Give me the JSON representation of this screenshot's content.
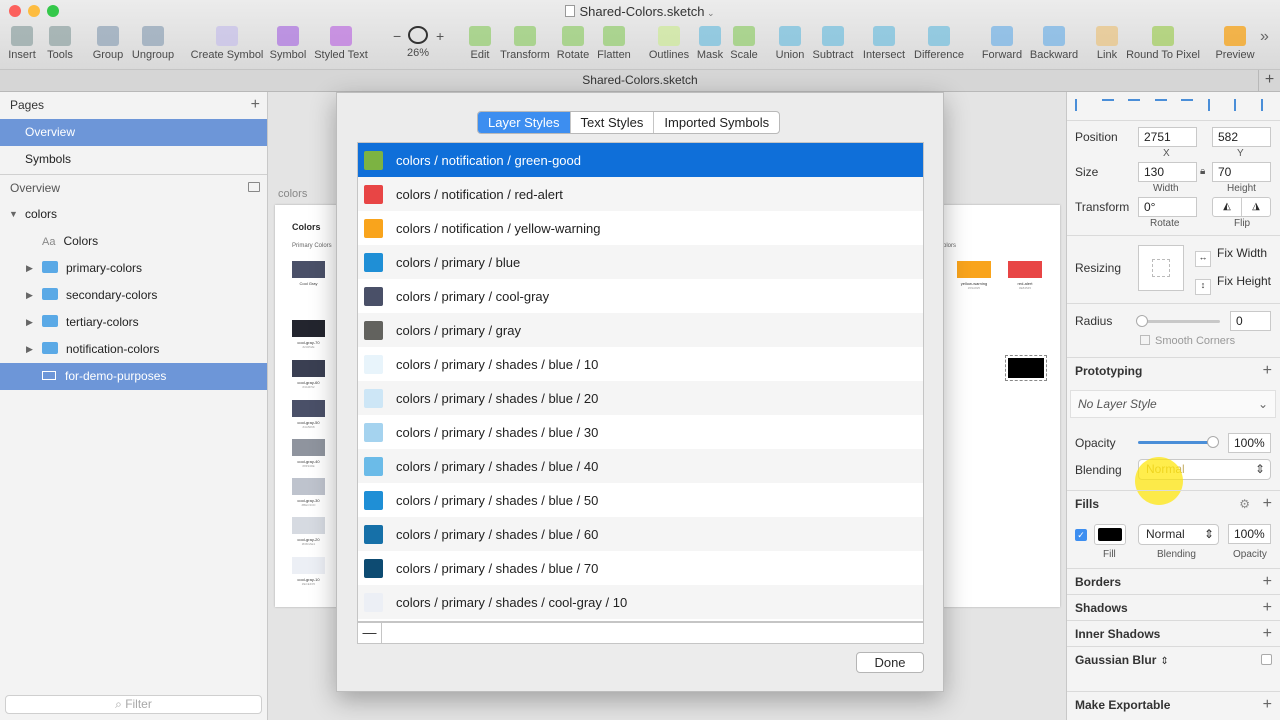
{
  "window": {
    "title": "Shared-Colors.sketch",
    "tab_title": "Shared-Colors.sketch"
  },
  "toolbar": {
    "items": [
      {
        "label": "Insert",
        "icon": "insert-icon"
      },
      {
        "label": "Tools",
        "icon": "tools-icon"
      },
      {
        "label": "Group",
        "icon": "group-icon"
      },
      {
        "label": "Ungroup",
        "icon": "ungroup-icon"
      },
      {
        "label": "Create Symbol",
        "icon": "create-symbol-icon"
      },
      {
        "label": "Symbol",
        "icon": "symbol-icon"
      },
      {
        "label": "Styled Text",
        "icon": "styled-text-icon"
      },
      {
        "label": "26%",
        "icon": "zoom-icon"
      },
      {
        "label": "Edit",
        "icon": "edit-icon"
      },
      {
        "label": "Transform",
        "icon": "transform-icon"
      },
      {
        "label": "Rotate",
        "icon": "rotate-icon"
      },
      {
        "label": "Flatten",
        "icon": "flatten-icon"
      },
      {
        "label": "Outlines",
        "icon": "outlines-icon"
      },
      {
        "label": "Mask",
        "icon": "mask-icon"
      },
      {
        "label": "Scale",
        "icon": "scale-icon"
      },
      {
        "label": "Union",
        "icon": "union-icon"
      },
      {
        "label": "Subtract",
        "icon": "subtract-icon"
      },
      {
        "label": "Intersect",
        "icon": "intersect-icon"
      },
      {
        "label": "Difference",
        "icon": "difference-icon"
      },
      {
        "label": "Forward",
        "icon": "forward-icon"
      },
      {
        "label": "Backward",
        "icon": "backward-icon"
      },
      {
        "label": "Link",
        "icon": "link-icon"
      },
      {
        "label": "Round To Pixel",
        "icon": "round-to-pixel-icon"
      },
      {
        "label": "Preview",
        "icon": "preview-icon"
      }
    ],
    "zoom_minus": "−",
    "zoom_plus": "+",
    "overflow": "»"
  },
  "left_panel": {
    "pages_title": "Pages",
    "pages": [
      "Overview",
      "Symbols"
    ],
    "layers_title": "Overview",
    "layers": [
      {
        "label": "colors",
        "kind": "artboard"
      },
      {
        "label": "Colors",
        "kind": "text"
      },
      {
        "label": "primary-colors",
        "kind": "folder"
      },
      {
        "label": "secondary-colors",
        "kind": "folder"
      },
      {
        "label": "tertiary-colors",
        "kind": "folder"
      },
      {
        "label": "notification-colors",
        "kind": "folder"
      },
      {
        "label": "for-demo-purposes",
        "kind": "shape"
      }
    ],
    "text_layer_glyph": "Aa",
    "filter_placeholder": "Filter"
  },
  "canvas": {
    "artboard_label": "colors",
    "artboard_title": "Colors",
    "section_label": "Primary Colors",
    "right_section_label": "olors",
    "swatches": [
      {
        "name": "Cool Gray",
        "hex": "",
        "color": "#4a5068"
      },
      {
        "name": "cool-gray-70",
        "hex": "#23252E",
        "color": "#23252e"
      },
      {
        "name": "cool-gray-60",
        "hex": "#3A3F52",
        "color": "#3a3f52"
      },
      {
        "name": "cool-gray-50",
        "hex": "#4A5068",
        "color": "#4a5068"
      },
      {
        "name": "cool-gray-40",
        "hex": "#8F949E",
        "color": "#8f949e"
      },
      {
        "name": "cool-gray-30",
        "hex": "#BEC3CD",
        "color": "#bec3cd"
      },
      {
        "name": "cool-gray-20",
        "hex": "#D6DAE1",
        "color": "#d6dae1"
      },
      {
        "name": "cool-gray-10",
        "hex": "#ECEFF5",
        "color": "#eceff5"
      }
    ],
    "notif_swatches": [
      {
        "name": "yellow-warning",
        "hex": "#F9A825",
        "color": "#f9a41c"
      },
      {
        "name": "red-alert",
        "hex": "#E84545",
        "color": "#e84545"
      }
    ]
  },
  "inspector": {
    "position_label": "Position",
    "x": "2751",
    "y": "582",
    "x_label": "X",
    "y_label": "Y",
    "size_label": "Size",
    "width": "130",
    "height": "70",
    "width_label": "Width",
    "height_label": "Height",
    "transform_label": "Transform",
    "rotate": "0°",
    "rotate_label": "Rotate",
    "flip_label": "Flip",
    "resizing_label": "Resizing",
    "fix_width": "Fix Width",
    "fix_height": "Fix Height",
    "radius_label": "Radius",
    "radius": "0",
    "smooth_corners": "Smooth Corners",
    "prototyping": "Prototyping",
    "layer_style": "No Layer Style",
    "opacity_label": "Opacity",
    "opacity": "100%",
    "blending_label": "Blending",
    "blending": "Normal",
    "fills": "Fills",
    "fill_blending": "Normal",
    "fill_opacity": "100%",
    "fill_label": "Fill",
    "fill_blending_label": "Blending",
    "fill_opacity_label": "Opacity",
    "borders": "Borders",
    "shadows": "Shadows",
    "inner_shadows": "Inner Shadows",
    "gaussian_blur": "Gaussian Blur",
    "make_exportable": "Make Exportable",
    "fill_color": "#000000",
    "opacity_fraction": 1.0
  },
  "modal": {
    "tabs": [
      "Layer Styles",
      "Text Styles",
      "Imported Symbols"
    ],
    "active_tab": 0,
    "styles": [
      {
        "name": "colors / notification / green-good",
        "color": "#7cb342"
      },
      {
        "name": "colors / notification / red-alert",
        "color": "#e84545"
      },
      {
        "name": "colors / notification / yellow-warning",
        "color": "#f9a41c"
      },
      {
        "name": "colors / primary / blue",
        "color": "#1f8fd6"
      },
      {
        "name": "colors / primary / cool-gray",
        "color": "#4a5068"
      },
      {
        "name": "colors / primary / gray",
        "color": "#62625e"
      },
      {
        "name": "colors / primary / shades / blue / 10",
        "color": "#e8f4fb"
      },
      {
        "name": "colors / primary / shades / blue / 20",
        "color": "#cde6f6"
      },
      {
        "name": "colors / primary / shades / blue / 30",
        "color": "#a5d3ef"
      },
      {
        "name": "colors / primary / shades / blue / 40",
        "color": "#6bbbe8"
      },
      {
        "name": "colors / primary / shades / blue / 50",
        "color": "#1f8fd6"
      },
      {
        "name": "colors / primary / shades / blue / 60",
        "color": "#1670a8"
      },
      {
        "name": "colors / primary / shades / blue / 70",
        "color": "#0d4b72"
      },
      {
        "name": "colors / primary / shades / cool-gray / 10",
        "color": "#eceff5"
      }
    ],
    "selected": 0,
    "remove_label": "—",
    "done_label": "Done"
  }
}
